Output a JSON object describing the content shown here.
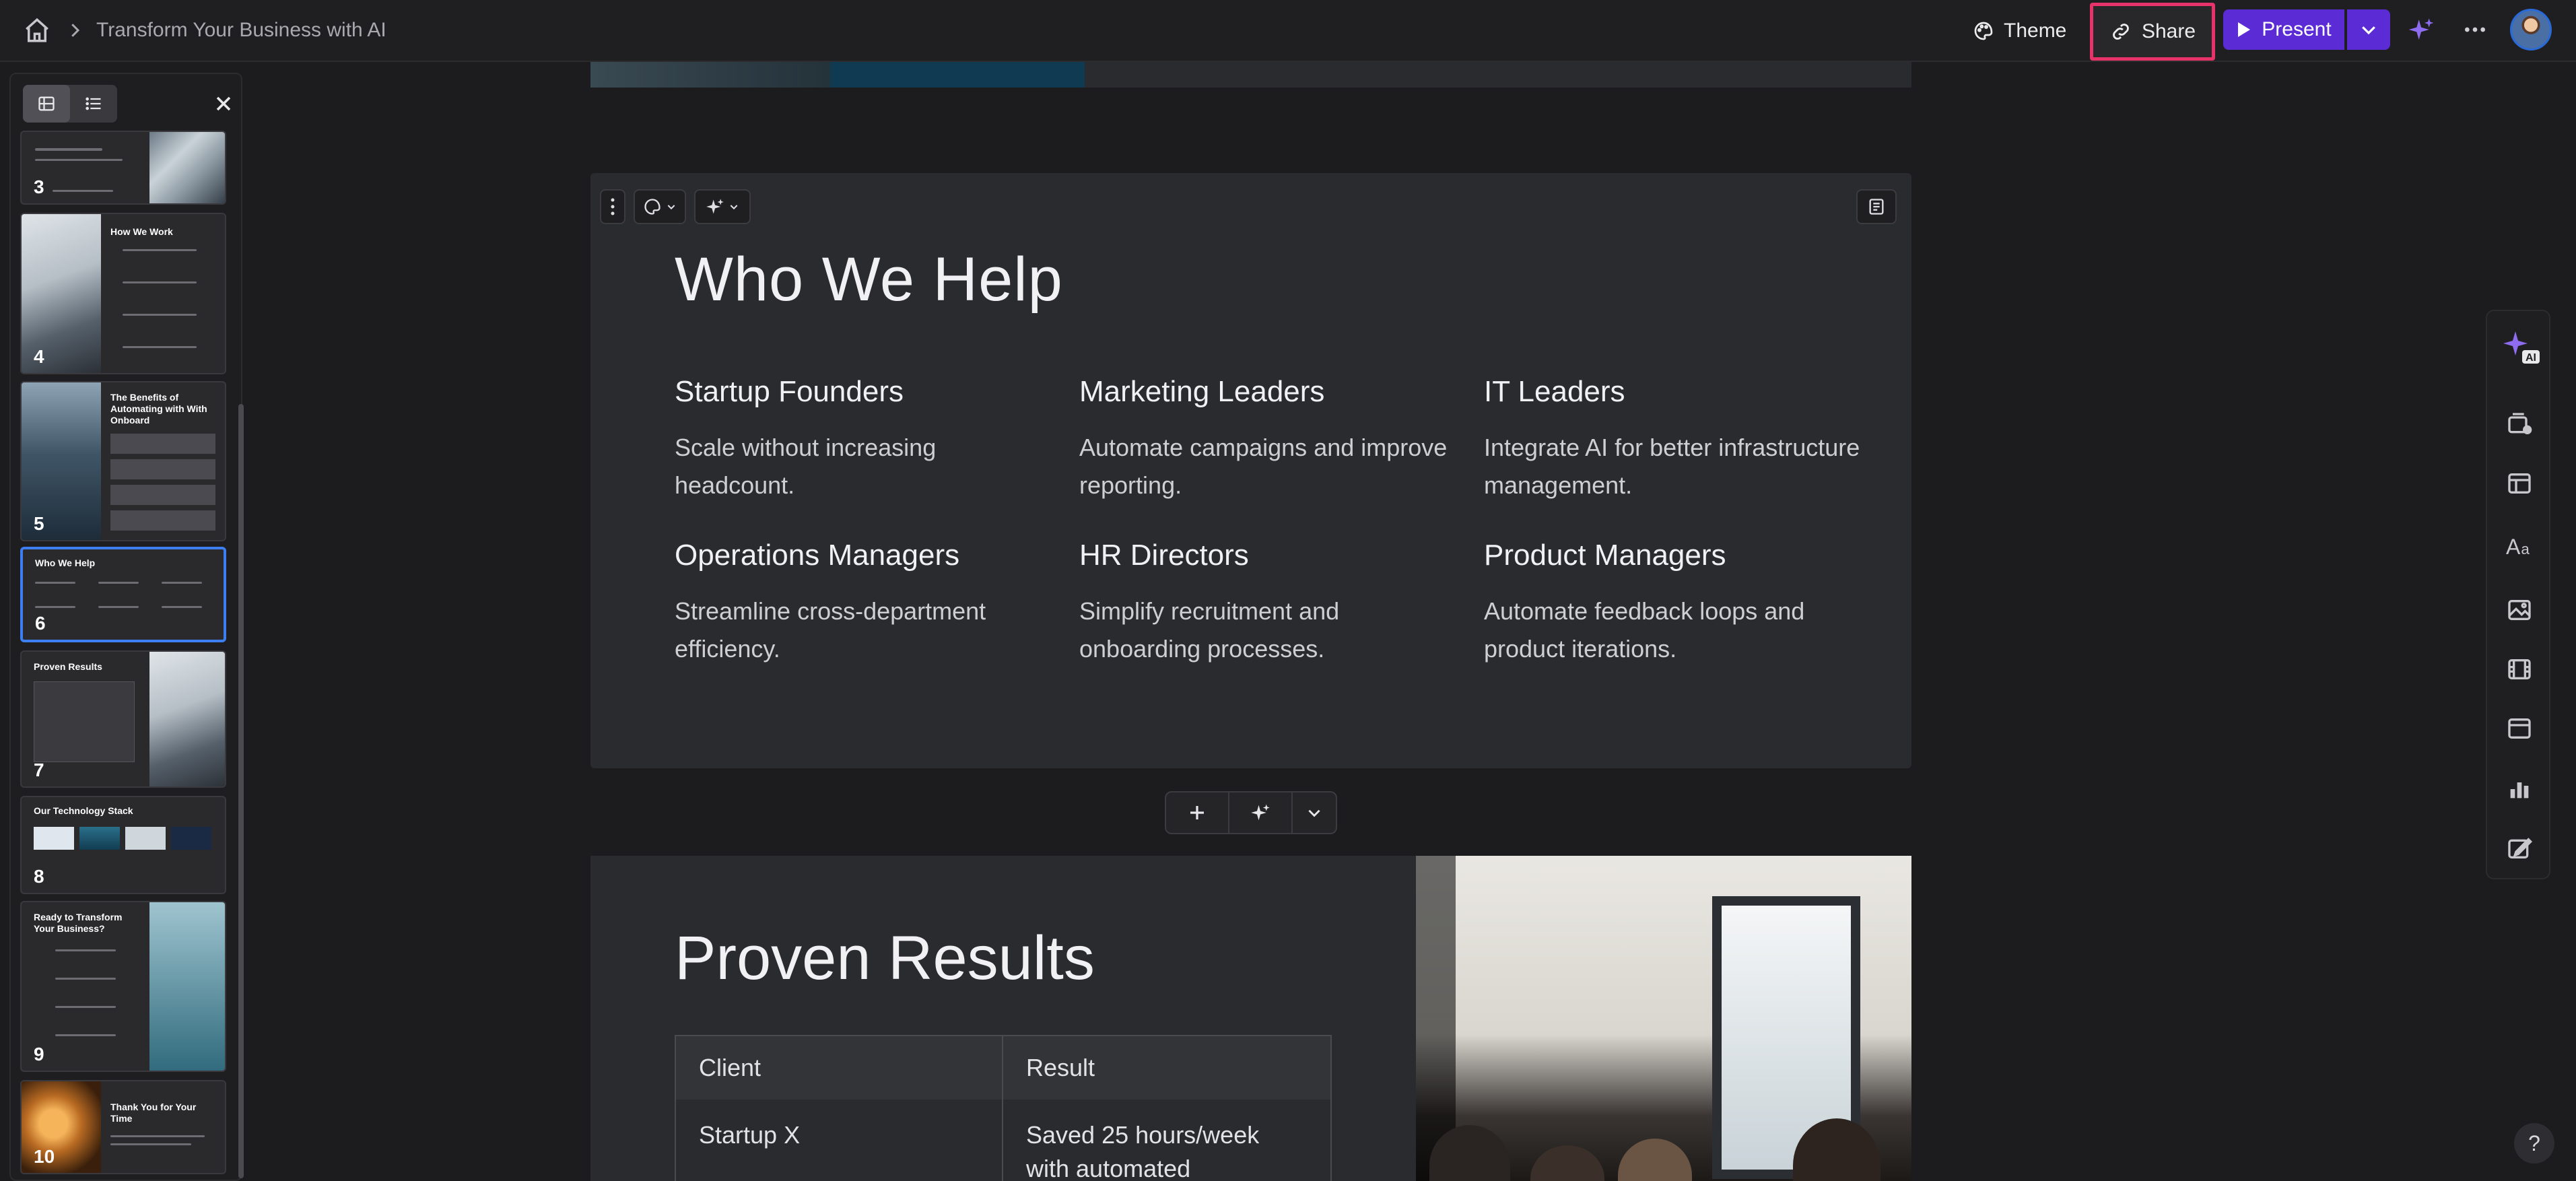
{
  "header": {
    "breadcrumb_title": "Transform Your Business with AI",
    "theme_label": "Theme",
    "share_label": "Share",
    "present_label": "Present"
  },
  "colors": {
    "accent_purple": "#5b2bd6",
    "share_highlight": "#e8336a",
    "active_slide_border": "#3d7ff0"
  },
  "slides_panel": {
    "thumbnails": [
      {
        "number": "3"
      },
      {
        "number": "4",
        "title": "How We Work"
      },
      {
        "number": "5",
        "title": "The Benefits of Automating with With Onboard"
      },
      {
        "number": "6",
        "title": "Who We Help"
      },
      {
        "number": "7",
        "title": "Proven Results"
      },
      {
        "number": "8",
        "title": "Our Technology Stack"
      },
      {
        "number": "9",
        "title": "Ready to Transform Your Business?"
      },
      {
        "number": "10",
        "title": "Thank You for Your Time"
      }
    ]
  },
  "slide_who_we_help": {
    "title": "Who We Help",
    "audiences": [
      {
        "heading": "Startup Founders",
        "text": "Scale without increasing headcount."
      },
      {
        "heading": "Marketing Leaders",
        "text": "Automate campaigns and improve reporting."
      },
      {
        "heading": "IT Leaders",
        "text": "Integrate AI for better infrastructure management."
      },
      {
        "heading": "Operations Managers",
        "text": "Streamline cross-department efficiency."
      },
      {
        "heading": "HR Directors",
        "text": "Simplify recruitment and onboarding processes."
      },
      {
        "heading": "Product Managers",
        "text": "Automate feedback loops and product iterations."
      }
    ]
  },
  "slide_proven_results": {
    "title": "Proven Results",
    "table": {
      "headers": [
        "Client",
        "Result"
      ],
      "rows": [
        [
          "Startup X",
          "Saved 25 hours/week with automated"
        ]
      ]
    }
  },
  "help_label": "?"
}
